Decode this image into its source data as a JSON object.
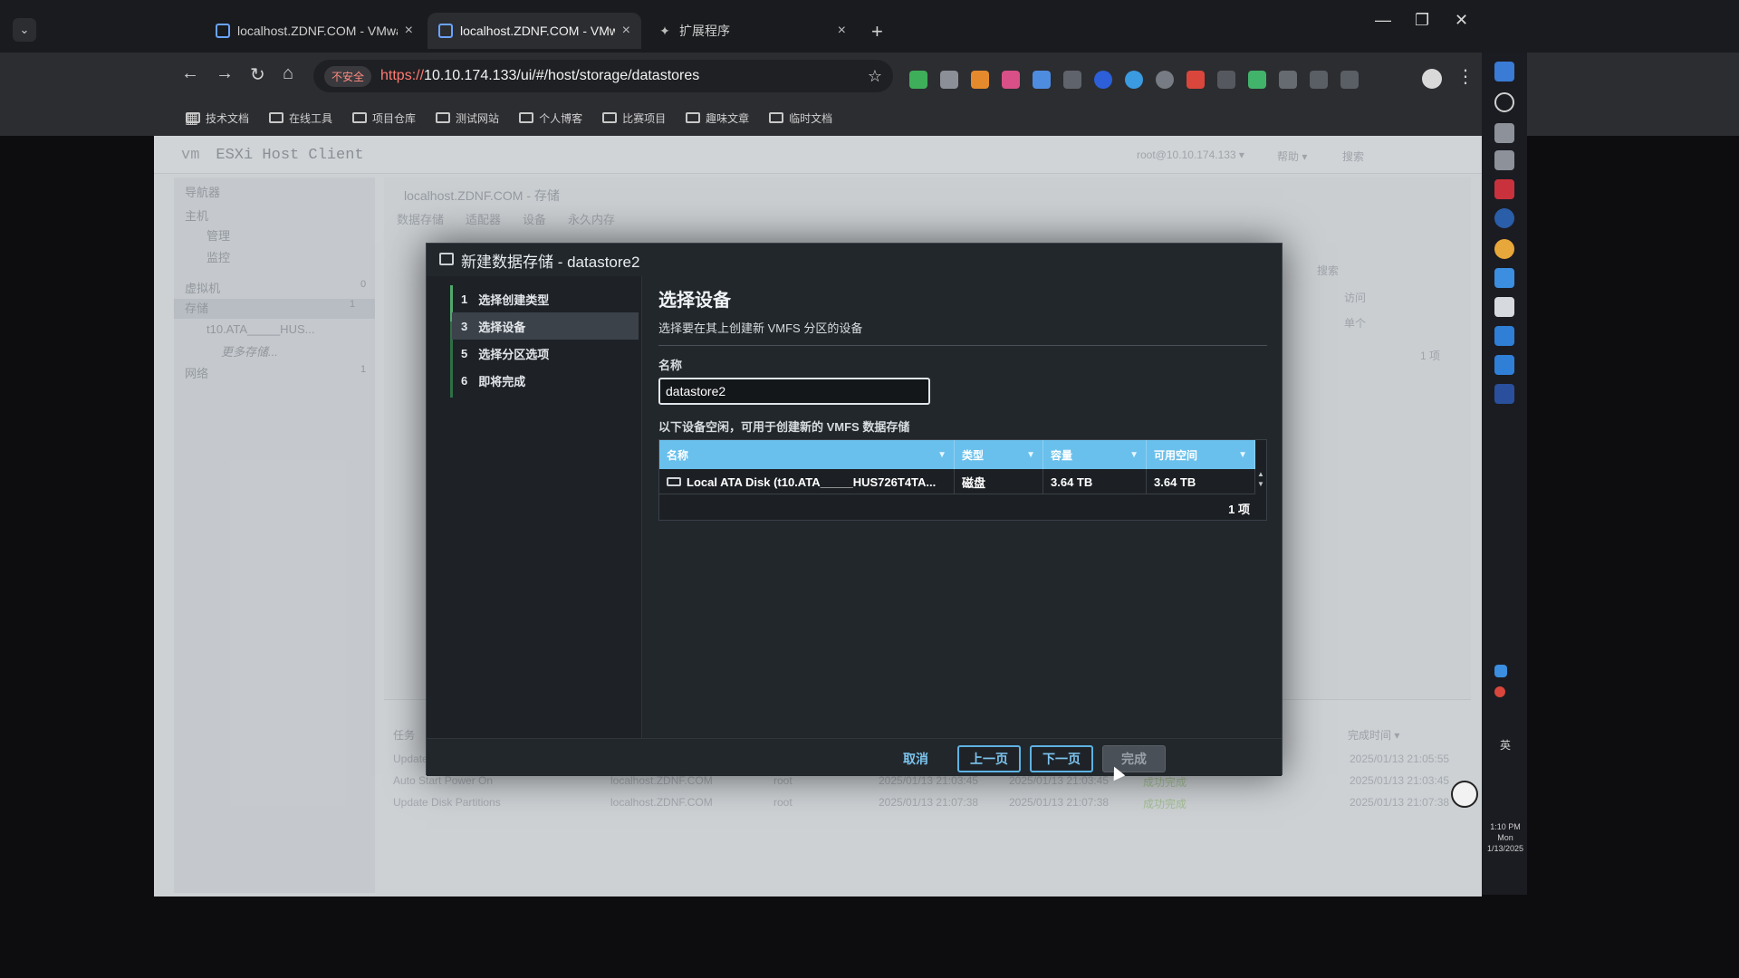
{
  "browser": {
    "tabs": [
      {
        "title": "localhost.ZDNF.COM - VMware ESXi",
        "close": "×"
      },
      {
        "title": "localhost.ZDNF.COM - VMware ESXi",
        "close": "×"
      },
      {
        "title": "扩展程序",
        "close": "×"
      }
    ],
    "new_tab": "+",
    "insecure_label": "不安全",
    "url_scheme": "https://",
    "url_rest": "10.10.174.133/ui/#/host/storage/datastores",
    "bookmarks": [
      "技术文档",
      "在线工具",
      "项目仓库",
      "测试网站",
      "个人博客",
      "比赛项目",
      "趣味文章",
      "临时文档"
    ]
  },
  "esxi": {
    "brand_vm": "vm",
    "brand": "ESXi Host Client",
    "user": "root@10.10.174.133 ▾",
    "help": "帮助 ▾",
    "search": "搜索",
    "nav": {
      "navigator": "导航器",
      "host": "主机",
      "manage": "管理",
      "monitor": "监控",
      "vms": "虚拟机",
      "vms_count": "0",
      "storage": "存储",
      "storage_count": "1",
      "datastore": "t10.ATA_____HUS...",
      "more_storage": "更多存储...",
      "network": "网络",
      "network_count": "1"
    },
    "content": {
      "title": "localhost.ZDNF.COM - 存储",
      "tabs": [
        "数据存储",
        "适配器",
        "设备",
        "永久内存"
      ],
      "search": "搜索",
      "col_access": "访问",
      "cell_single": "单个",
      "count": "1 项"
    },
    "tasks": {
      "headers": [
        "任务",
        "完成时间 ▾"
      ],
      "rows": [
        {
          "task": "Update",
          "target": "",
          "initiator": "",
          "queued": "",
          "started": "",
          "result": "",
          "completed": "2025/01/13 21:05:55"
        },
        {
          "task": "Auto Start Power On",
          "target": "localhost.ZDNF.COM",
          "initiator": "root",
          "queued": "2025/01/13 21:03:45",
          "started": "2025/01/13 21:03:45",
          "result": "成功完成",
          "completed": "2025/01/13 21:03:45"
        },
        {
          "task": "Update Disk Partitions",
          "target": "localhost.ZDNF.COM",
          "initiator": "root",
          "queued": "2025/01/13 21:07:38",
          "started": "2025/01/13 21:07:38",
          "result": "成功完成",
          "completed": "2025/01/13 21:07:38"
        }
      ]
    }
  },
  "modal": {
    "title": "新建数据存储 - datastore2",
    "steps": [
      {
        "num": "1",
        "label": "选择创建类型"
      },
      {
        "num": "3",
        "label": "选择设备"
      },
      {
        "num": "5",
        "label": "选择分区选项"
      },
      {
        "num": "6",
        "label": "即将完成"
      }
    ],
    "heading": "选择设备",
    "subheading": "选择要在其上创建新 VMFS 分区的设备",
    "name_label": "名称",
    "name_value": "datastore2",
    "devices_label": "以下设备空闲，可用于创建新的 VMFS 数据存储",
    "grid": {
      "headers": [
        "名称",
        "类型",
        "容量",
        "可用空间"
      ],
      "rows": [
        {
          "name": "Local ATA Disk (t10.ATA_____HUS726T4TA...",
          "type": "磁盘",
          "capacity": "3.64 TB",
          "free": "3.64 TB"
        }
      ],
      "count": "1 项"
    },
    "buttons": {
      "cancel": "取消",
      "prev": "上一页",
      "next": "下一页",
      "finish": "完成"
    }
  },
  "os": {
    "time": "1:10 PM",
    "day": "Mon",
    "date": "1/13/2025",
    "ime": "英"
  },
  "colors": {
    "grid_header": "#6ac0ec",
    "accent": "#5fb2e2",
    "wizard_bar": "#4fa96c"
  }
}
